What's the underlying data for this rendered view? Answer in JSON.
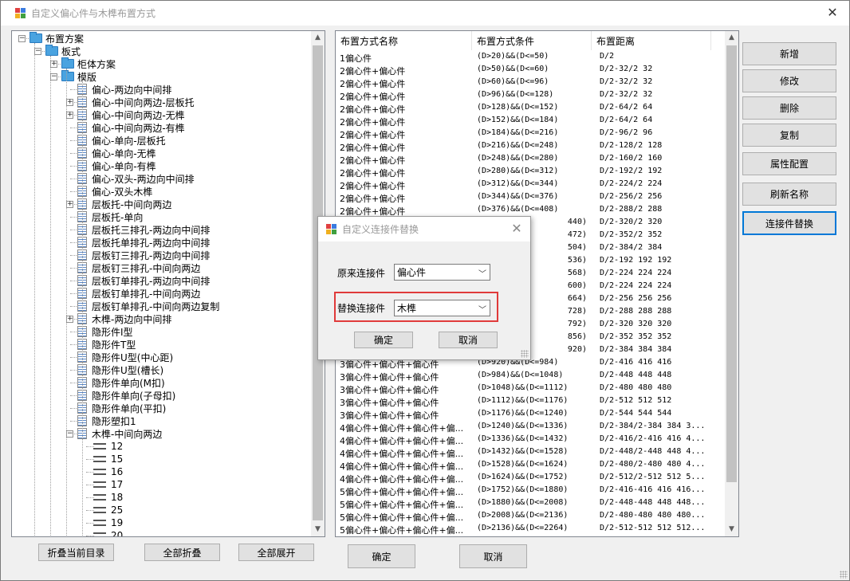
{
  "window": {
    "title": "自定义偏心件与木榫布置方式"
  },
  "tree": {
    "nodes": [
      {
        "label": "布置方案",
        "depth": 0,
        "icon": "folder",
        "expander": "-"
      },
      {
        "label": "板式",
        "depth": 1,
        "icon": "folder",
        "expander": "-"
      },
      {
        "label": "柜体方案",
        "depth": 2,
        "icon": "folder",
        "expander": "+"
      },
      {
        "label": "模版",
        "depth": 2,
        "icon": "folder",
        "expander": "-"
      },
      {
        "label": "偏心-两边向中间排",
        "depth": 3,
        "icon": "doc",
        "expander": ""
      },
      {
        "label": "偏心-中间向两边-层板托",
        "depth": 3,
        "icon": "doc",
        "expander": "+"
      },
      {
        "label": "偏心-中间向两边-无榫",
        "depth": 3,
        "icon": "doc",
        "expander": "+"
      },
      {
        "label": "偏心-中间向两边-有榫",
        "depth": 3,
        "icon": "doc",
        "expander": ""
      },
      {
        "label": "偏心-单向-层板托",
        "depth": 3,
        "icon": "doc",
        "expander": ""
      },
      {
        "label": "偏心-单向-无榫",
        "depth": 3,
        "icon": "doc",
        "expander": ""
      },
      {
        "label": "偏心-单向-有榫",
        "depth": 3,
        "icon": "doc",
        "expander": ""
      },
      {
        "label": "偏心-双头-两边向中间排",
        "depth": 3,
        "icon": "doc",
        "expander": ""
      },
      {
        "label": "偏心-双头木榫",
        "depth": 3,
        "icon": "doc",
        "expander": ""
      },
      {
        "label": "层板托-中间向两边",
        "depth": 3,
        "icon": "doc",
        "expander": "+"
      },
      {
        "label": "层板托-单向",
        "depth": 3,
        "icon": "doc",
        "expander": ""
      },
      {
        "label": "层板托三排孔-两边向中间排",
        "depth": 3,
        "icon": "doc",
        "expander": ""
      },
      {
        "label": "层板托单排孔-两边向中间排",
        "depth": 3,
        "icon": "doc",
        "expander": ""
      },
      {
        "label": "层板钉三排孔-两边向中间排",
        "depth": 3,
        "icon": "doc",
        "expander": ""
      },
      {
        "label": "层板钉三排孔-中间向两边",
        "depth": 3,
        "icon": "doc",
        "expander": ""
      },
      {
        "label": "层板钉单排孔-两边向中间排",
        "depth": 3,
        "icon": "doc",
        "expander": ""
      },
      {
        "label": "层板钉单排孔-中间向两边",
        "depth": 3,
        "icon": "doc",
        "expander": ""
      },
      {
        "label": "层板钉单排孔-中间向两边复制",
        "depth": 3,
        "icon": "doc",
        "expander": ""
      },
      {
        "label": "木榫-两边向中间排",
        "depth": 3,
        "icon": "doc",
        "expander": "+"
      },
      {
        "label": "隐形件I型",
        "depth": 3,
        "icon": "doc",
        "expander": ""
      },
      {
        "label": "隐形件T型",
        "depth": 3,
        "icon": "doc",
        "expander": ""
      },
      {
        "label": "隐形件U型(中心距)",
        "depth": 3,
        "icon": "doc",
        "expander": ""
      },
      {
        "label": "隐形件U型(槽长)",
        "depth": 3,
        "icon": "doc",
        "expander": ""
      },
      {
        "label": "隐形件单向(M扣)",
        "depth": 3,
        "icon": "doc",
        "expander": ""
      },
      {
        "label": "隐形件单向(子母扣)",
        "depth": 3,
        "icon": "doc",
        "expander": ""
      },
      {
        "label": "隐形件单向(平扣)",
        "depth": 3,
        "icon": "doc",
        "expander": ""
      },
      {
        "label": "隐形塑扣1",
        "depth": 3,
        "icon": "doc",
        "expander": ""
      },
      {
        "label": "木榫-中间向两边",
        "depth": 3,
        "icon": "doc",
        "expander": "-"
      },
      {
        "label": "12",
        "depth": 4,
        "icon": "leaf",
        "expander": ""
      },
      {
        "label": "15",
        "depth": 4,
        "icon": "leaf",
        "expander": ""
      },
      {
        "label": "16",
        "depth": 4,
        "icon": "leaf",
        "expander": ""
      },
      {
        "label": "17",
        "depth": 4,
        "icon": "leaf",
        "expander": ""
      },
      {
        "label": "18",
        "depth": 4,
        "icon": "leaf",
        "expander": ""
      },
      {
        "label": "25",
        "depth": 4,
        "icon": "leaf",
        "expander": ""
      },
      {
        "label": "19",
        "depth": 4,
        "icon": "leaf",
        "expander": ""
      },
      {
        "label": "20",
        "depth": 4,
        "icon": "leaf",
        "expander": ""
      }
    ]
  },
  "tree_buttons": {
    "collapse_current": "折叠当前目录",
    "collapse_all": "全部折叠",
    "expand_all": "全部展开"
  },
  "list": {
    "headers": [
      "布置方式名称",
      "布置方式条件",
      "布置距离"
    ],
    "rows": [
      [
        "1偏心件",
        "(D>20)&&(D<=50)",
        "D/2"
      ],
      [
        "2偏心件+偏心件",
        "(D>50)&&(D<=60)",
        "D/2-32/2 32"
      ],
      [
        "2偏心件+偏心件",
        "(D>60)&&(D<=96)",
        "D/2-32/2 32"
      ],
      [
        "2偏心件+偏心件",
        "(D>96)&&(D<=128)",
        "D/2-32/2 32"
      ],
      [
        "2偏心件+偏心件",
        "(D>128)&&(D<=152)",
        "D/2-64/2 64"
      ],
      [
        "2偏心件+偏心件",
        "(D>152)&&(D<=184)",
        "D/2-64/2 64"
      ],
      [
        "2偏心件+偏心件",
        "(D>184)&&(D<=216)",
        "D/2-96/2 96"
      ],
      [
        "2偏心件+偏心件",
        "(D>216)&&(D<=248)",
        "D/2-128/2 128"
      ],
      [
        "2偏心件+偏心件",
        "(D>248)&&(D<=280)",
        "D/2-160/2 160"
      ],
      [
        "2偏心件+偏心件",
        "(D>280)&&(D<=312)",
        "D/2-192/2 192"
      ],
      [
        "2偏心件+偏心件",
        "(D>312)&&(D<=344)",
        "D/2-224/2 224"
      ],
      [
        "2偏心件+偏心件",
        "(D>344)&&(D<=376)",
        "D/2-256/2 256"
      ],
      [
        "2偏心件+偏心件",
        "(D>376)&&(D<=408)",
        "D/2-288/2 288"
      ],
      [
        "",
        "440)",
        "D/2-320/2 320"
      ],
      [
        "",
        "472)",
        "D/2-352/2 352"
      ],
      [
        "",
        "504)",
        "D/2-384/2 384"
      ],
      [
        "",
        "536)",
        "D/2-192 192 192"
      ],
      [
        "",
        "568)",
        "D/2-224 224 224"
      ],
      [
        "",
        "600)",
        "D/2-224 224 224"
      ],
      [
        "",
        "664)",
        "D/2-256 256 256"
      ],
      [
        "",
        "728)",
        "D/2-288 288 288"
      ],
      [
        "",
        "792)",
        "D/2-320 320 320"
      ],
      [
        "",
        "856)",
        "D/2-352 352 352"
      ],
      [
        "",
        "920)",
        "D/2-384 384 384"
      ],
      [
        "3偏心件+偏心件+偏心件",
        "(D>920)&&(D<=984)",
        "D/2-416 416 416"
      ],
      [
        "3偏心件+偏心件+偏心件",
        "(D>984)&&(D<=1048)",
        "D/2-448 448 448"
      ],
      [
        "3偏心件+偏心件+偏心件",
        "(D>1048)&&(D<=1112)",
        "D/2-480 480 480"
      ],
      [
        "3偏心件+偏心件+偏心件",
        "(D>1112)&&(D<=1176)",
        "D/2-512 512 512"
      ],
      [
        "3偏心件+偏心件+偏心件",
        "(D>1176)&&(D<=1240)",
        "D/2-544 544 544"
      ],
      [
        "4偏心件+偏心件+偏心件+偏...",
        "(D>1240)&&(D<=1336)",
        "D/2-384/2-384 384 3..."
      ],
      [
        "4偏心件+偏心件+偏心件+偏...",
        "(D>1336)&&(D<=1432)",
        "D/2-416/2-416 416 4..."
      ],
      [
        "4偏心件+偏心件+偏心件+偏...",
        "(D>1432)&&(D<=1528)",
        "D/2-448/2-448 448 4..."
      ],
      [
        "4偏心件+偏心件+偏心件+偏...",
        "(D>1528)&&(D<=1624)",
        "D/2-480/2-480 480 4..."
      ],
      [
        "4偏心件+偏心件+偏心件+偏...",
        "(D>1624)&&(D<=1752)",
        "D/2-512/2-512 512 5..."
      ],
      [
        "5偏心件+偏心件+偏心件+偏...",
        "(D>1752)&&(D<=1880)",
        "D/2-416-416 416 416..."
      ],
      [
        "5偏心件+偏心件+偏心件+偏...",
        "(D>1880)&&(D<=2008)",
        "D/2-448-448 448 448..."
      ],
      [
        "5偏心件+偏心件+偏心件+偏...",
        "(D>2008)&&(D<=2136)",
        "D/2-480-480 480 480..."
      ],
      [
        "5偏心件+偏心件+偏心件+偏...",
        "(D>2136)&&(D<=2264)",
        "D/2-512-512 512 512..."
      ]
    ]
  },
  "side_buttons": [
    "新增",
    "修改",
    "删除",
    "复制",
    "属性配置",
    "刷新名称",
    "连接件替换"
  ],
  "bottom_buttons": {
    "ok": "确定",
    "cancel": "取消"
  },
  "dialog": {
    "title": "自定义连接件替换",
    "original_label": "原来连接件",
    "original_value": "偏心件",
    "replace_label": "替换连接件",
    "replace_value": "木榫",
    "ok": "确定",
    "cancel": "取消"
  },
  "colors": {
    "accent": "#0078d7",
    "highlight": "#e03a3a"
  }
}
